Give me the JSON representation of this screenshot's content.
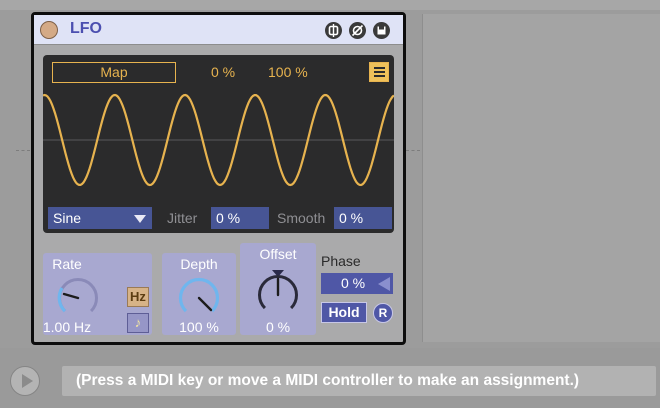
{
  "device": {
    "title": "LFO",
    "title_buttons": [
      "fold-icon",
      "hot-swap-icon",
      "save-icon"
    ],
    "map_label": "Map",
    "min_label": "0 %",
    "max_label": "100 %",
    "waveform": {
      "shape_value": "Sine"
    },
    "jitter_label": "Jitter",
    "jitter_value": "0 %",
    "smooth_label": "Smooth",
    "smooth_value": "0 %",
    "rate": {
      "label": "Rate",
      "value": "1.00 Hz",
      "unit_hz": "Hz",
      "unit_sync": "♪"
    },
    "depth": {
      "label": "Depth",
      "value": "100 %"
    },
    "offset": {
      "label": "Offset",
      "value": "0 %"
    },
    "phase": {
      "label": "Phase",
      "value": "0 %"
    },
    "hold_label": "Hold",
    "retrigger_label": "R"
  },
  "status_bar": {
    "message": "(Press a MIDI key or move a MIDI controller to make an assignment.)"
  },
  "colors": {
    "accent": "#e7b34f",
    "title_text": "#4b4fb0",
    "field_bg": "#475595",
    "panel_bg": "#a8a8d0",
    "knob_ring": "#6fb6ee"
  }
}
